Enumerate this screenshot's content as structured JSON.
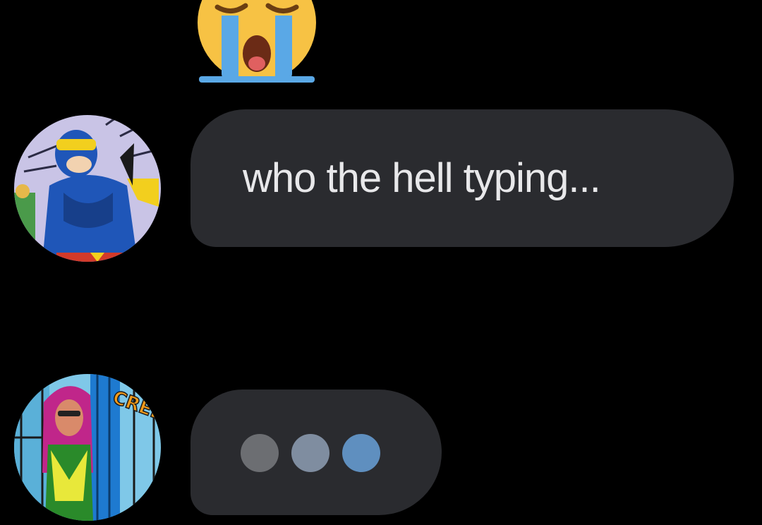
{
  "messages": [
    {
      "reaction": "loudly-crying-face-emoji",
      "sender_avatar": "cyclops-comic-avatar",
      "text": "who the hell typing..."
    },
    {
      "sender_avatar": "phoenix-comic-avatar",
      "typing_indicator": true,
      "avatar_sfx_text": "CREEEA"
    }
  ],
  "colors": {
    "background": "#000000",
    "bubble": "#2a2b2f",
    "text": "#e8e8ea",
    "typing_dots": [
      "#6c6e72",
      "#7f8da0",
      "#5f8fbf"
    ]
  }
}
